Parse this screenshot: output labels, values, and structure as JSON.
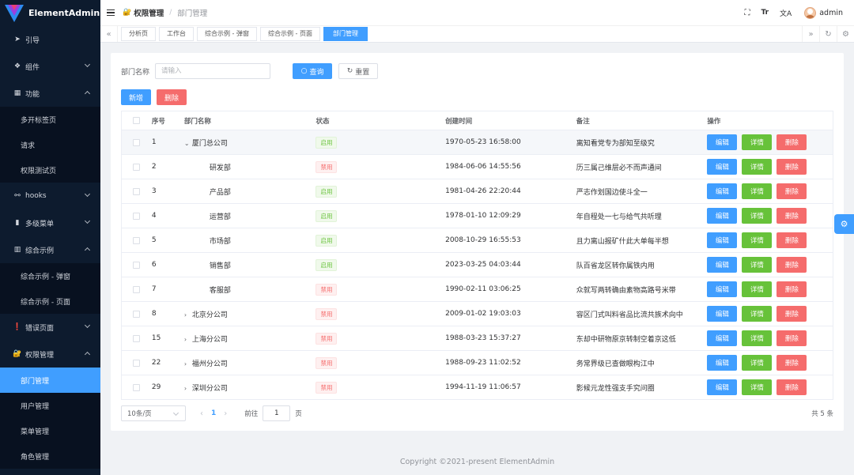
{
  "app": {
    "name": "ElementAdmin"
  },
  "sidebar": {
    "items": [
      {
        "label": "引导",
        "icon": "paper-plane-icon",
        "expandable": false
      },
      {
        "label": "组件",
        "icon": "components-icon",
        "expandable": true,
        "open": false
      },
      {
        "label": "功能",
        "icon": "grid-icon",
        "expandable": true,
        "open": true,
        "children": [
          "多开标签页",
          "请求",
          "权限测试页"
        ]
      },
      {
        "label": "hooks",
        "icon": "hooks-icon",
        "expandable": true,
        "open": false
      },
      {
        "label": "多级菜单",
        "icon": "bar-chart-icon",
        "expandable": true,
        "open": false
      },
      {
        "label": "综合示例",
        "icon": "example-icon",
        "expandable": true,
        "open": true,
        "children": [
          "综合示例 - 弹窗",
          "综合示例 - 页面"
        ]
      },
      {
        "label": "错误页面",
        "icon": "error-icon",
        "expandable": true,
        "open": false
      },
      {
        "label": "权限管理",
        "icon": "permission-icon",
        "expandable": true,
        "open": true,
        "children": [
          "部门管理",
          "用户管理",
          "菜单管理",
          "角色管理"
        ],
        "active_child": "部门管理"
      }
    ]
  },
  "header": {
    "breadcrumb": [
      "权限管理",
      "部门管理"
    ],
    "username": "admin",
    "icons": [
      "fullscreen-icon",
      "font-size-icon",
      "translate-icon"
    ]
  },
  "tags": [
    "分析页",
    "工作台",
    "综合示例 - 弹窗",
    "综合示例 - 页面",
    "部门管理"
  ],
  "active_tag": "部门管理",
  "search": {
    "label": "部门名称",
    "placeholder": "请输入",
    "value": "",
    "query_label": "查询",
    "reset_label": "重置"
  },
  "actions": {
    "add_label": "新增",
    "delete_label": "删除"
  },
  "table": {
    "columns": [
      "序号",
      "部门名称",
      "状态",
      "创建时间",
      "备注",
      "操作"
    ],
    "rows": [
      {
        "id": "1",
        "name": "厦门总公司",
        "tree": "expanded",
        "indent": 0,
        "status": "启用",
        "enabled": true,
        "created": "1970-05-23 16:58:00",
        "remark": "离知看党专为部知至级究"
      },
      {
        "id": "2",
        "name": "研发部",
        "tree": "none",
        "indent": 1,
        "status": "禁用",
        "enabled": false,
        "created": "1984-06-06 14:55:56",
        "remark": "历三属己维层必不而声通间"
      },
      {
        "id": "3",
        "name": "产品部",
        "tree": "none",
        "indent": 1,
        "status": "启用",
        "enabled": true,
        "created": "1981-04-26 22:20:44",
        "remark": "严志作划国边使斗全一"
      },
      {
        "id": "4",
        "name": "运营部",
        "tree": "none",
        "indent": 1,
        "status": "启用",
        "enabled": true,
        "created": "1978-01-10 12:09:29",
        "remark": "年自程处一七与给气共听理"
      },
      {
        "id": "5",
        "name": "市场部",
        "tree": "none",
        "indent": 1,
        "status": "启用",
        "enabled": true,
        "created": "2008-10-29 16:55:53",
        "remark": "且力离山报矿什此大单每半想"
      },
      {
        "id": "6",
        "name": "销售部",
        "tree": "none",
        "indent": 1,
        "status": "启用",
        "enabled": true,
        "created": "2023-03-25 04:03:44",
        "remark": "队百省龙区转你属铁内用"
      },
      {
        "id": "7",
        "name": "客服部",
        "tree": "none",
        "indent": 1,
        "status": "禁用",
        "enabled": false,
        "created": "1990-02-11 03:06:25",
        "remark": "众就写两转确由素物高路号米带"
      },
      {
        "id": "8",
        "name": "北京分公司",
        "tree": "collapsed",
        "indent": 0,
        "status": "禁用",
        "enabled": false,
        "created": "2009-01-02 19:03:03",
        "remark": "容区门式叫料省品比流共族术向中"
      },
      {
        "id": "15",
        "name": "上海分公司",
        "tree": "collapsed",
        "indent": 0,
        "status": "禁用",
        "enabled": false,
        "created": "1988-03-23 15:37:27",
        "remark": "东却中研物原京转制空着京这低"
      },
      {
        "id": "22",
        "name": "福州分公司",
        "tree": "collapsed",
        "indent": 0,
        "status": "禁用",
        "enabled": false,
        "created": "1988-09-23 11:02:52",
        "remark": "务常界级已查做眼构江中"
      },
      {
        "id": "29",
        "name": "深圳分公司",
        "tree": "collapsed",
        "indent": 0,
        "status": "禁用",
        "enabled": false,
        "created": "1994-11-19 11:06:57",
        "remark": "影候元龙性强支手究问圈"
      }
    ],
    "row_buttons": {
      "edit": "编辑",
      "detail": "详情",
      "delete": "删除"
    }
  },
  "pagination": {
    "page_size": "10条/页",
    "current": "1",
    "goto_label": "前往",
    "goto_value": "1",
    "page_suffix": "页",
    "total": "共 5 条"
  },
  "footer": {
    "copyright": "Copyright ©2021-present ElementAdmin"
  },
  "colors": {
    "sidebar_bg": "#0d1b2e",
    "primary": "#409eff",
    "success": "#67c23a",
    "danger": "#f56c6c"
  }
}
